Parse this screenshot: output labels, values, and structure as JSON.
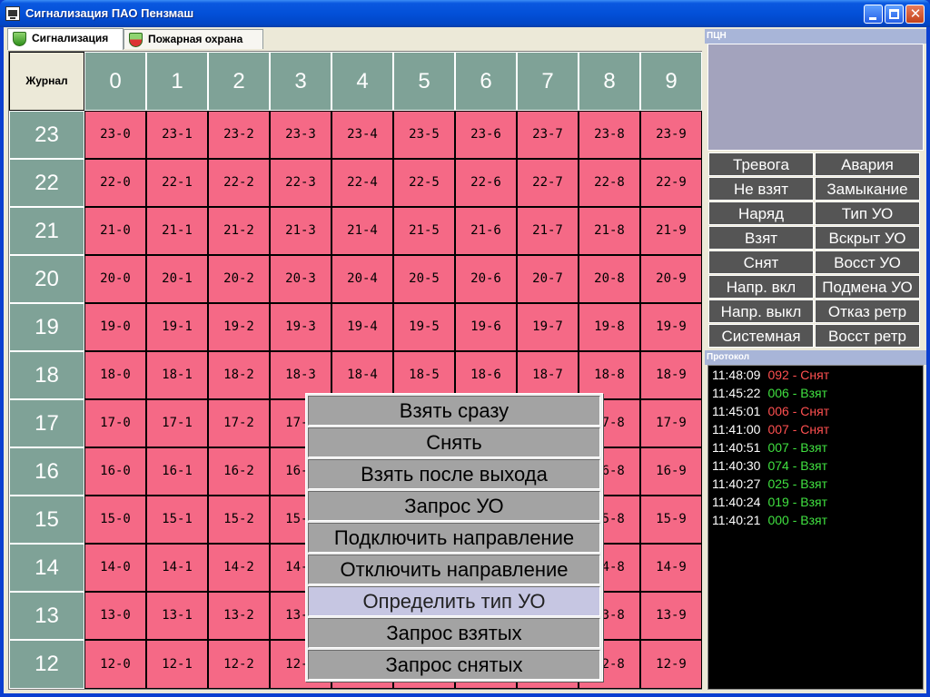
{
  "window": {
    "title": "Сигнализация ПАО Пензмаш"
  },
  "tabs": [
    {
      "label": "Сигнализация",
      "active": true
    },
    {
      "label": "Пожарная охрана",
      "active": false
    }
  ],
  "grid": {
    "corner_label": "Журнал",
    "columns": [
      "0",
      "1",
      "2",
      "3",
      "4",
      "5",
      "6",
      "7",
      "8",
      "9"
    ],
    "rows": [
      "23",
      "22",
      "21",
      "20",
      "19",
      "18",
      "17",
      "16",
      "15",
      "14",
      "13",
      "12"
    ],
    "zone_color": "#f56986",
    "header_color": "#7fa297"
  },
  "context_menu": {
    "items": [
      {
        "label": "Взять сразу",
        "highlighted": false
      },
      {
        "label": "Снять",
        "highlighted": false
      },
      {
        "label": "Взять после выхода",
        "highlighted": false
      },
      {
        "label": "Запрос УО",
        "highlighted": false
      },
      {
        "label": "Подключить направление",
        "highlighted": false
      },
      {
        "label": "Отключить направление",
        "highlighted": false
      },
      {
        "label": "Определить тип УО",
        "highlighted": true
      },
      {
        "label": "Запрос взятых",
        "highlighted": false
      },
      {
        "label": "Запрос снятых",
        "highlighted": false
      }
    ]
  },
  "right_panel": {
    "pcn_title": "ПЦН",
    "status_buttons": [
      [
        "Тревога",
        "Авария"
      ],
      [
        "Не взят",
        "Замыкание"
      ],
      [
        "Наряд",
        "Тип УО"
      ],
      [
        "Взят",
        "Вскрыт УО"
      ],
      [
        "Снят",
        "Восст УО"
      ],
      [
        "Напр. вкл",
        "Подмена УО"
      ],
      [
        "Напр. выкл",
        "Отказ ретр"
      ],
      [
        "Системная",
        "Восст ретр"
      ]
    ],
    "protocol_title": "Протокол",
    "protocol": [
      {
        "time": "11:48:09",
        "event": "092 - Снят",
        "color": "#ff5050"
      },
      {
        "time": "11:45:22",
        "event": "006 - Взят",
        "color": "#40e040"
      },
      {
        "time": "11:45:01",
        "event": "006 - Снят",
        "color": "#ff5050"
      },
      {
        "time": "11:41:00",
        "event": "007 - Снят",
        "color": "#ff5050"
      },
      {
        "time": "11:40:51",
        "event": "007 - Взят",
        "color": "#40e040"
      },
      {
        "time": "11:40:30",
        "event": "074 - Взят",
        "color": "#40e040"
      },
      {
        "time": "11:40:27",
        "event": "025 - Взят",
        "color": "#40e040"
      },
      {
        "time": "11:40:24",
        "event": "019 - Взят",
        "color": "#40e040"
      },
      {
        "time": "11:40:21",
        "event": "000 - Взят",
        "color": "#40e040"
      }
    ]
  }
}
